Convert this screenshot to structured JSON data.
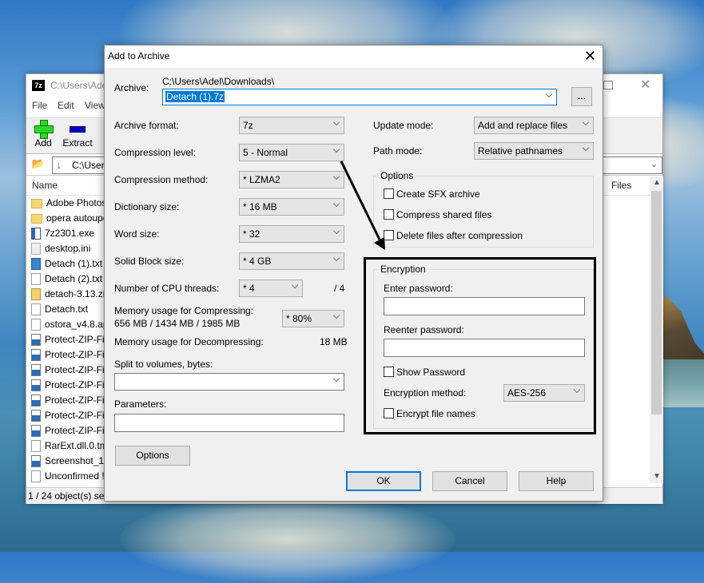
{
  "background_window": {
    "title_path": "C:\\Users\\Ade",
    "app_icon_label": "7z",
    "menu": [
      "File",
      "Edit",
      "View"
    ],
    "toolbar": [
      {
        "label": "Add",
        "icon": "plus-icon"
      },
      {
        "label": "Extract",
        "icon": "minus-icon"
      }
    ],
    "address": "C:\\Users",
    "columns": {
      "name": "Name",
      "files": "Files"
    },
    "files": [
      {
        "name": "Adobe Photos",
        "icon": "folder"
      },
      {
        "name": "opera autoupc",
        "icon": "folder"
      },
      {
        "name": "7z2301.exe",
        "icon": "exe"
      },
      {
        "name": "desktop.ini",
        "icon": "ini"
      },
      {
        "name": "Detach (1).txt",
        "icon": "txtsel"
      },
      {
        "name": "Detach (2).txt",
        "icon": "txt"
      },
      {
        "name": "detach-3.13.zip",
        "icon": "zip"
      },
      {
        "name": "Detach.txt",
        "icon": "txt"
      },
      {
        "name": "ostora_v4.8.ap",
        "icon": "file"
      },
      {
        "name": "Protect-ZIP-Fi",
        "icon": "img"
      },
      {
        "name": "Protect-ZIP-Fi",
        "icon": "img"
      },
      {
        "name": "Protect-ZIP-Fi",
        "icon": "img"
      },
      {
        "name": "Protect-ZIP-Fi",
        "icon": "img"
      },
      {
        "name": "Protect-ZIP-Fi",
        "icon": "img"
      },
      {
        "name": "Protect-ZIP-Fi",
        "icon": "img"
      },
      {
        "name": "Protect-ZIP-Fi",
        "icon": "img"
      },
      {
        "name": "RarExt.dll.0.tm",
        "icon": "file"
      },
      {
        "name": "Screenshot_1.j",
        "icon": "img"
      },
      {
        "name": "Unconfirmed !",
        "icon": "file"
      }
    ],
    "status": "1 / 24 object(s) sele"
  },
  "dialog": {
    "title": "Add to Archive",
    "close_glyph": "X",
    "archive": {
      "label": "Archive:",
      "folder": "C:\\Users\\Adel\\Downloads\\",
      "value": "Detach (1).7z",
      "browse_label": "..."
    },
    "left": {
      "archive_format": {
        "label": "Archive format:",
        "value": "7z"
      },
      "compression_level": {
        "label": "Compression level:",
        "value": "5 - Normal"
      },
      "compression_method": {
        "label": "Compression method:",
        "value": "*  LZMA2"
      },
      "dictionary_size": {
        "label": "Dictionary size:",
        "value": "*  16 MB"
      },
      "word_size": {
        "label": "Word size:",
        "value": "*  32"
      },
      "solid_block_size": {
        "label": "Solid Block size:",
        "value": "*  4 GB"
      },
      "cpu_threads": {
        "label": "Number of CPU threads:",
        "value": "*  4",
        "max": "/ 4"
      },
      "memory_compress": {
        "label": "Memory usage for Compressing:",
        "detail": "656 MB / 1434 MB / 1985 MB",
        "value": "*  80%"
      },
      "memory_decompress": {
        "label": "Memory usage for Decompressing:",
        "value": "18 MB"
      },
      "split_volumes": {
        "label": "Split to volumes, bytes:",
        "value": ""
      },
      "parameters": {
        "label": "Parameters:",
        "value": ""
      },
      "options_button": "Options"
    },
    "right": {
      "update_mode": {
        "label": "Update mode:",
        "value": "Add and replace files"
      },
      "path_mode": {
        "label": "Path mode:",
        "value": "Relative pathnames"
      },
      "options_group": {
        "title": "Options",
        "checkboxes": [
          {
            "label": "Create SFX archive",
            "checked": false
          },
          {
            "label": "Compress shared files",
            "checked": false
          },
          {
            "label": "Delete files after compression",
            "checked": false
          }
        ]
      },
      "encryption_group": {
        "title": "Encryption",
        "enter_password_label": "Enter password:",
        "enter_password_value": "",
        "reenter_password_label": "Reenter password:",
        "reenter_password_value": "",
        "show_password": {
          "label": "Show Password",
          "checked": false
        },
        "method_label": "Encryption method:",
        "method_value": "AES-256",
        "encrypt_names": {
          "label": "Encrypt file names",
          "checked": false
        }
      }
    },
    "buttons": {
      "ok": "OK",
      "cancel": "Cancel",
      "help": "Help"
    },
    "annotation_color": "#000000",
    "accent_color": "#0078d7"
  }
}
